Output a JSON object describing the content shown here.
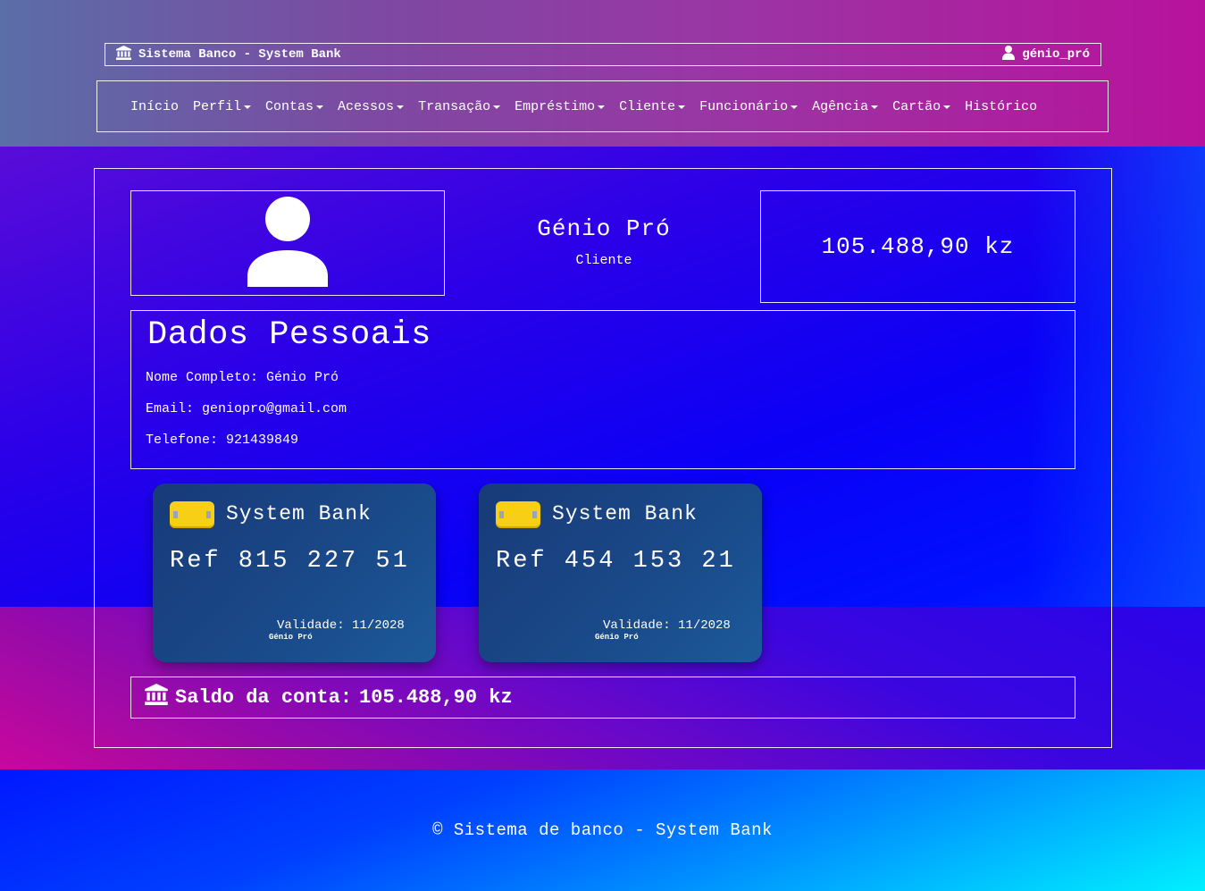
{
  "header": {
    "brand": "Sistema Banco - System Bank",
    "brand_icon": "bank-icon",
    "username": "génio_pró",
    "user_icon": "user-icon"
  },
  "nav": {
    "items": [
      {
        "label": "Início",
        "dropdown": false
      },
      {
        "label": "Perfil",
        "dropdown": true
      },
      {
        "label": "Contas",
        "dropdown": true
      },
      {
        "label": "Acessos",
        "dropdown": true
      },
      {
        "label": "Transação",
        "dropdown": true
      },
      {
        "label": "Empréstimo",
        "dropdown": true
      },
      {
        "label": "Cliente",
        "dropdown": true
      },
      {
        "label": "Funcionário",
        "dropdown": true
      },
      {
        "label": "Agência",
        "dropdown": true
      },
      {
        "label": "Cartão",
        "dropdown": true
      },
      {
        "label": "Histórico",
        "dropdown": false
      }
    ]
  },
  "profile": {
    "avatar_icon": "user-avatar-icon",
    "name": "Génio Pró",
    "role": "Cliente",
    "balance": "105.488,90 kz"
  },
  "personal": {
    "title": "Dados Pessoais",
    "full_name": "Nome Completo: Génio Pró",
    "email": "Email: geniopro@gmail.com",
    "phone": "Telefone: 921439849"
  },
  "cards": [
    {
      "bank": "System Bank",
      "ref": "Ref 815 227 51",
      "validity": "Validade: 11/2028",
      "holder": "Génio Pró"
    },
    {
      "bank": "System Bank",
      "ref": "Ref 454 153 21",
      "validity": "Validade: 11/2028",
      "holder": "Génio Pró"
    }
  ],
  "saldo": {
    "icon": "bank-icon",
    "label": "Saldo da conta:",
    "value": "105.488,90 kz"
  },
  "footer": {
    "text": "© Sistema de banco - System Bank"
  },
  "colors": {
    "chip": "#f7cf14",
    "card_bg": "#1a4a8a",
    "header_left": "#5a6ea8",
    "header_right": "#b8129c",
    "footer_right": "#00f0ff"
  }
}
